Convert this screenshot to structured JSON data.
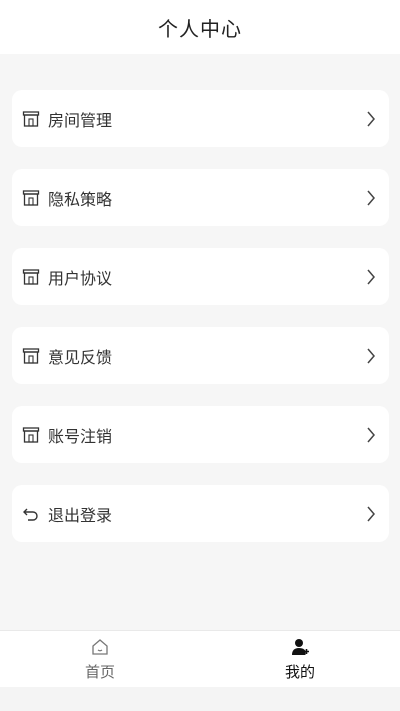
{
  "header": {
    "title": "个人中心"
  },
  "menu": {
    "items": [
      {
        "label": "房间管理",
        "icon": "store-icon"
      },
      {
        "label": "隐私策略",
        "icon": "store-icon"
      },
      {
        "label": "用户协议",
        "icon": "store-icon"
      },
      {
        "label": "意见反馈",
        "icon": "store-icon"
      },
      {
        "label": "账号注销",
        "icon": "store-icon"
      },
      {
        "label": "退出登录",
        "icon": "return-arrow-icon"
      }
    ]
  },
  "tabbar": {
    "tabs": [
      {
        "label": "首页",
        "icon": "home-icon",
        "active": false
      },
      {
        "label": "我的",
        "icon": "user-icon",
        "active": true
      }
    ]
  },
  "colors": {
    "background": "#f4f4f4",
    "card": "#ffffff",
    "text": "#333333",
    "inactive_tab": "#666666",
    "active_tab": "#111111"
  }
}
